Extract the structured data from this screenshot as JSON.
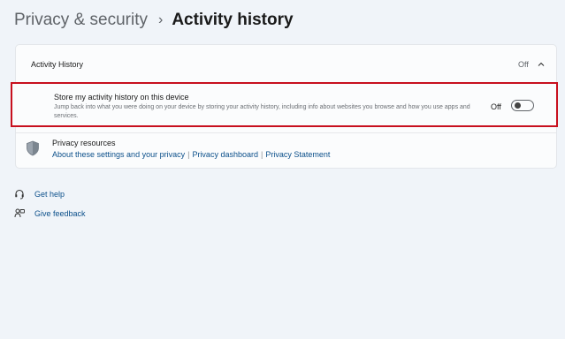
{
  "breadcrumb": {
    "parent": "Privacy & security",
    "separator": "›",
    "current": "Activity history"
  },
  "activity_history": {
    "title": "Activity History",
    "state": "Off",
    "expanded_icon": "chevron-up-icon",
    "setting": {
      "label": "Store my activity history on this device",
      "description": "Jump back into what you were doing on your device by storing your activity history, including info about websites you browse and how you use apps and services.",
      "toggle_state": "Off",
      "toggle_on": false
    },
    "resources": {
      "icon": "shield-icon",
      "title": "Privacy resources",
      "links": [
        "About these settings and your privacy",
        "Privacy dashboard",
        "Privacy Statement"
      ],
      "separator": "|"
    }
  },
  "help": {
    "get_help": {
      "icon": "help-headset-icon",
      "label": "Get help"
    },
    "give_feedback": {
      "icon": "feedback-icon",
      "label": "Give feedback"
    }
  },
  "colors": {
    "background": "#f0f4f9",
    "card": "#fbfcfd",
    "link": "#0b4f8a",
    "highlight_border": "#c8101e"
  }
}
